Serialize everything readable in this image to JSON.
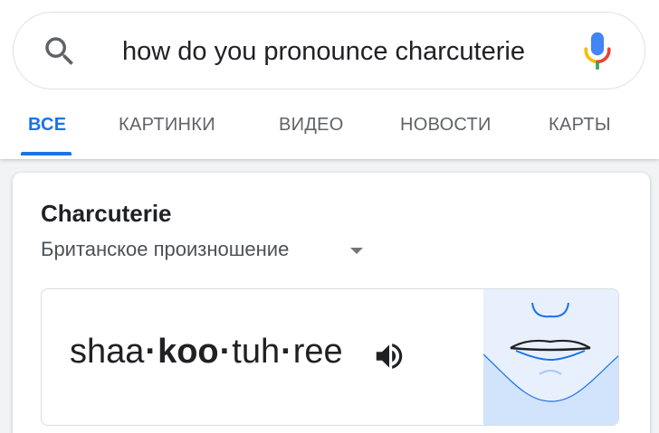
{
  "search": {
    "query": "how do you pronounce charcuterie",
    "search_icon": "magnifier-icon",
    "mic_icon": "microphone-icon"
  },
  "tabs": [
    {
      "label": "ВСЕ",
      "active": true
    },
    {
      "label": "КАРТИНКИ",
      "active": false
    },
    {
      "label": "ВИДЕО",
      "active": false
    },
    {
      "label": "НОВОСТИ",
      "active": false
    },
    {
      "label": "КАРТЫ",
      "active": false
    }
  ],
  "card": {
    "title": "Charcuterie",
    "dialect": "Британское произношение",
    "phonetic": {
      "syllable_1": "shaa",
      "syllable_2": "koo",
      "syllable_3": "tuh",
      "syllable_4": "ree",
      "separator": "·"
    },
    "speaker_icon": "speaker-icon",
    "mouth_illustration": "mouth-diagram"
  },
  "colors": {
    "accent": "#1a73e8",
    "mic_blue": "#4285f4",
    "mic_red": "#ea4335",
    "mic_yellow": "#fbbc04",
    "mic_green": "#34a853",
    "mouth_bg": "#e8f0fe"
  }
}
